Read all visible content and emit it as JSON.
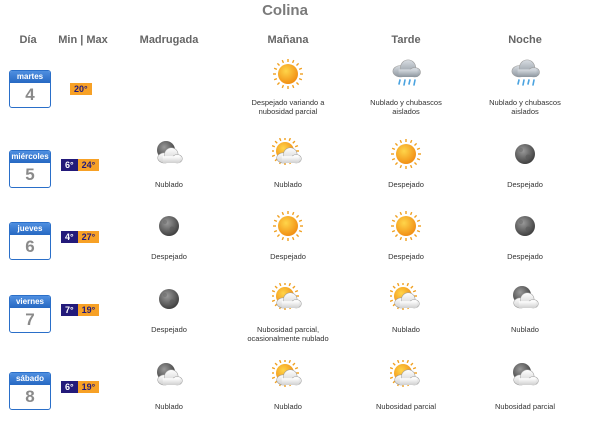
{
  "title": "Colina",
  "headers": [
    "Día",
    "Min | Max",
    "Madrugada",
    "Mañana",
    "Tarde",
    "Noche"
  ],
  "days": [
    {
      "name": "martes",
      "num": "4",
      "min": "",
      "max": "20°",
      "periods": [
        null,
        {
          "icon": "sun-icon",
          "desc": [
            "Despejado variando a",
            "nubosidad parcial"
          ]
        },
        {
          "icon": "cloud-rain-icon",
          "desc": [
            "Nublado y chubascos",
            "aislados"
          ]
        },
        {
          "icon": "cloud-rain-icon",
          "desc": [
            "Nublado y chubascos",
            "aislados"
          ]
        }
      ]
    },
    {
      "name": "miércoles",
      "num": "5",
      "min": "6°",
      "max": "24°",
      "periods": [
        {
          "icon": "night-cloud-icon",
          "desc": [
            "Nublado"
          ]
        },
        {
          "icon": "sun-cloud-icon",
          "desc": [
            "Nublado"
          ]
        },
        {
          "icon": "sun-icon",
          "desc": [
            "Despejado"
          ]
        },
        {
          "icon": "moon-icon",
          "desc": [
            "Despejado"
          ]
        }
      ]
    },
    {
      "name": "jueves",
      "num": "6",
      "min": "4°",
      "max": "27°",
      "periods": [
        {
          "icon": "moon-icon",
          "desc": [
            "Despejado"
          ]
        },
        {
          "icon": "sun-icon",
          "desc": [
            "Despejado"
          ]
        },
        {
          "icon": "sun-icon",
          "desc": [
            "Despejado"
          ]
        },
        {
          "icon": "moon-icon",
          "desc": [
            "Despejado"
          ]
        }
      ]
    },
    {
      "name": "viernes",
      "num": "7",
      "min": "7°",
      "max": "19°",
      "periods": [
        {
          "icon": "moon-icon",
          "desc": [
            "Despejado"
          ]
        },
        {
          "icon": "sun-cloud-icon",
          "desc": [
            "Nubosidad parcial,",
            "ocasionalmente nublado"
          ]
        },
        {
          "icon": "sun-cloud-icon",
          "desc": [
            "Nublado"
          ]
        },
        {
          "icon": "night-cloud-icon",
          "desc": [
            "Nublado"
          ]
        }
      ]
    },
    {
      "name": "sábado",
      "num": "8",
      "min": "6°",
      "max": "19°",
      "periods": [
        {
          "icon": "night-cloud-icon",
          "desc": [
            "Nublado"
          ]
        },
        {
          "icon": "sun-cloud-icon",
          "desc": [
            "Nublado"
          ]
        },
        {
          "icon": "sun-cloud-icon",
          "desc": [
            "Nubosidad parcial"
          ]
        },
        {
          "icon": "night-cloud-icon",
          "desc": [
            "Nubosidad parcial"
          ]
        }
      ]
    }
  ],
  "colors": {
    "calendar_blue": "#2a6fc9",
    "min_bg": "#231a7a",
    "max_bg": "#f7a126",
    "sun": "#f5a623"
  }
}
